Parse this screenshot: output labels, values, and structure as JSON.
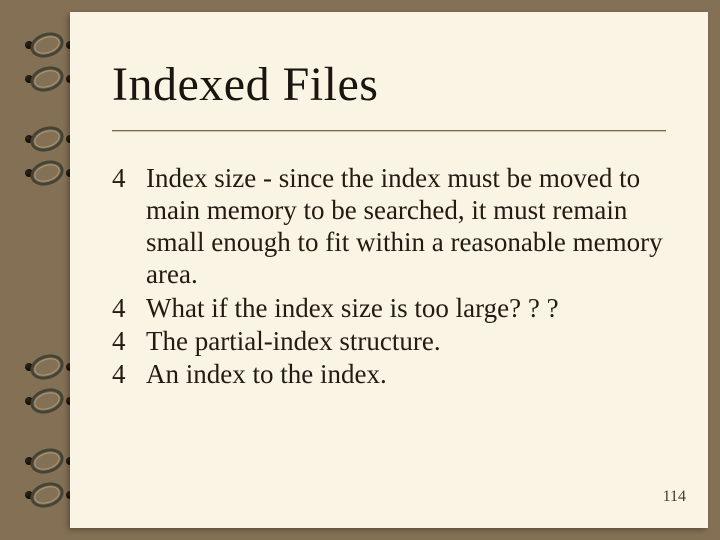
{
  "title": "Indexed Files",
  "bullet_glyph": "4",
  "bullets": [
    "Index size - since the index must be moved to main memory to be searched, it must remain small enough to fit within a reasonable memory area.",
    "What if the index size is too large? ? ?",
    "The partial-index structure.",
    "An index to the index."
  ],
  "page_number": "114"
}
